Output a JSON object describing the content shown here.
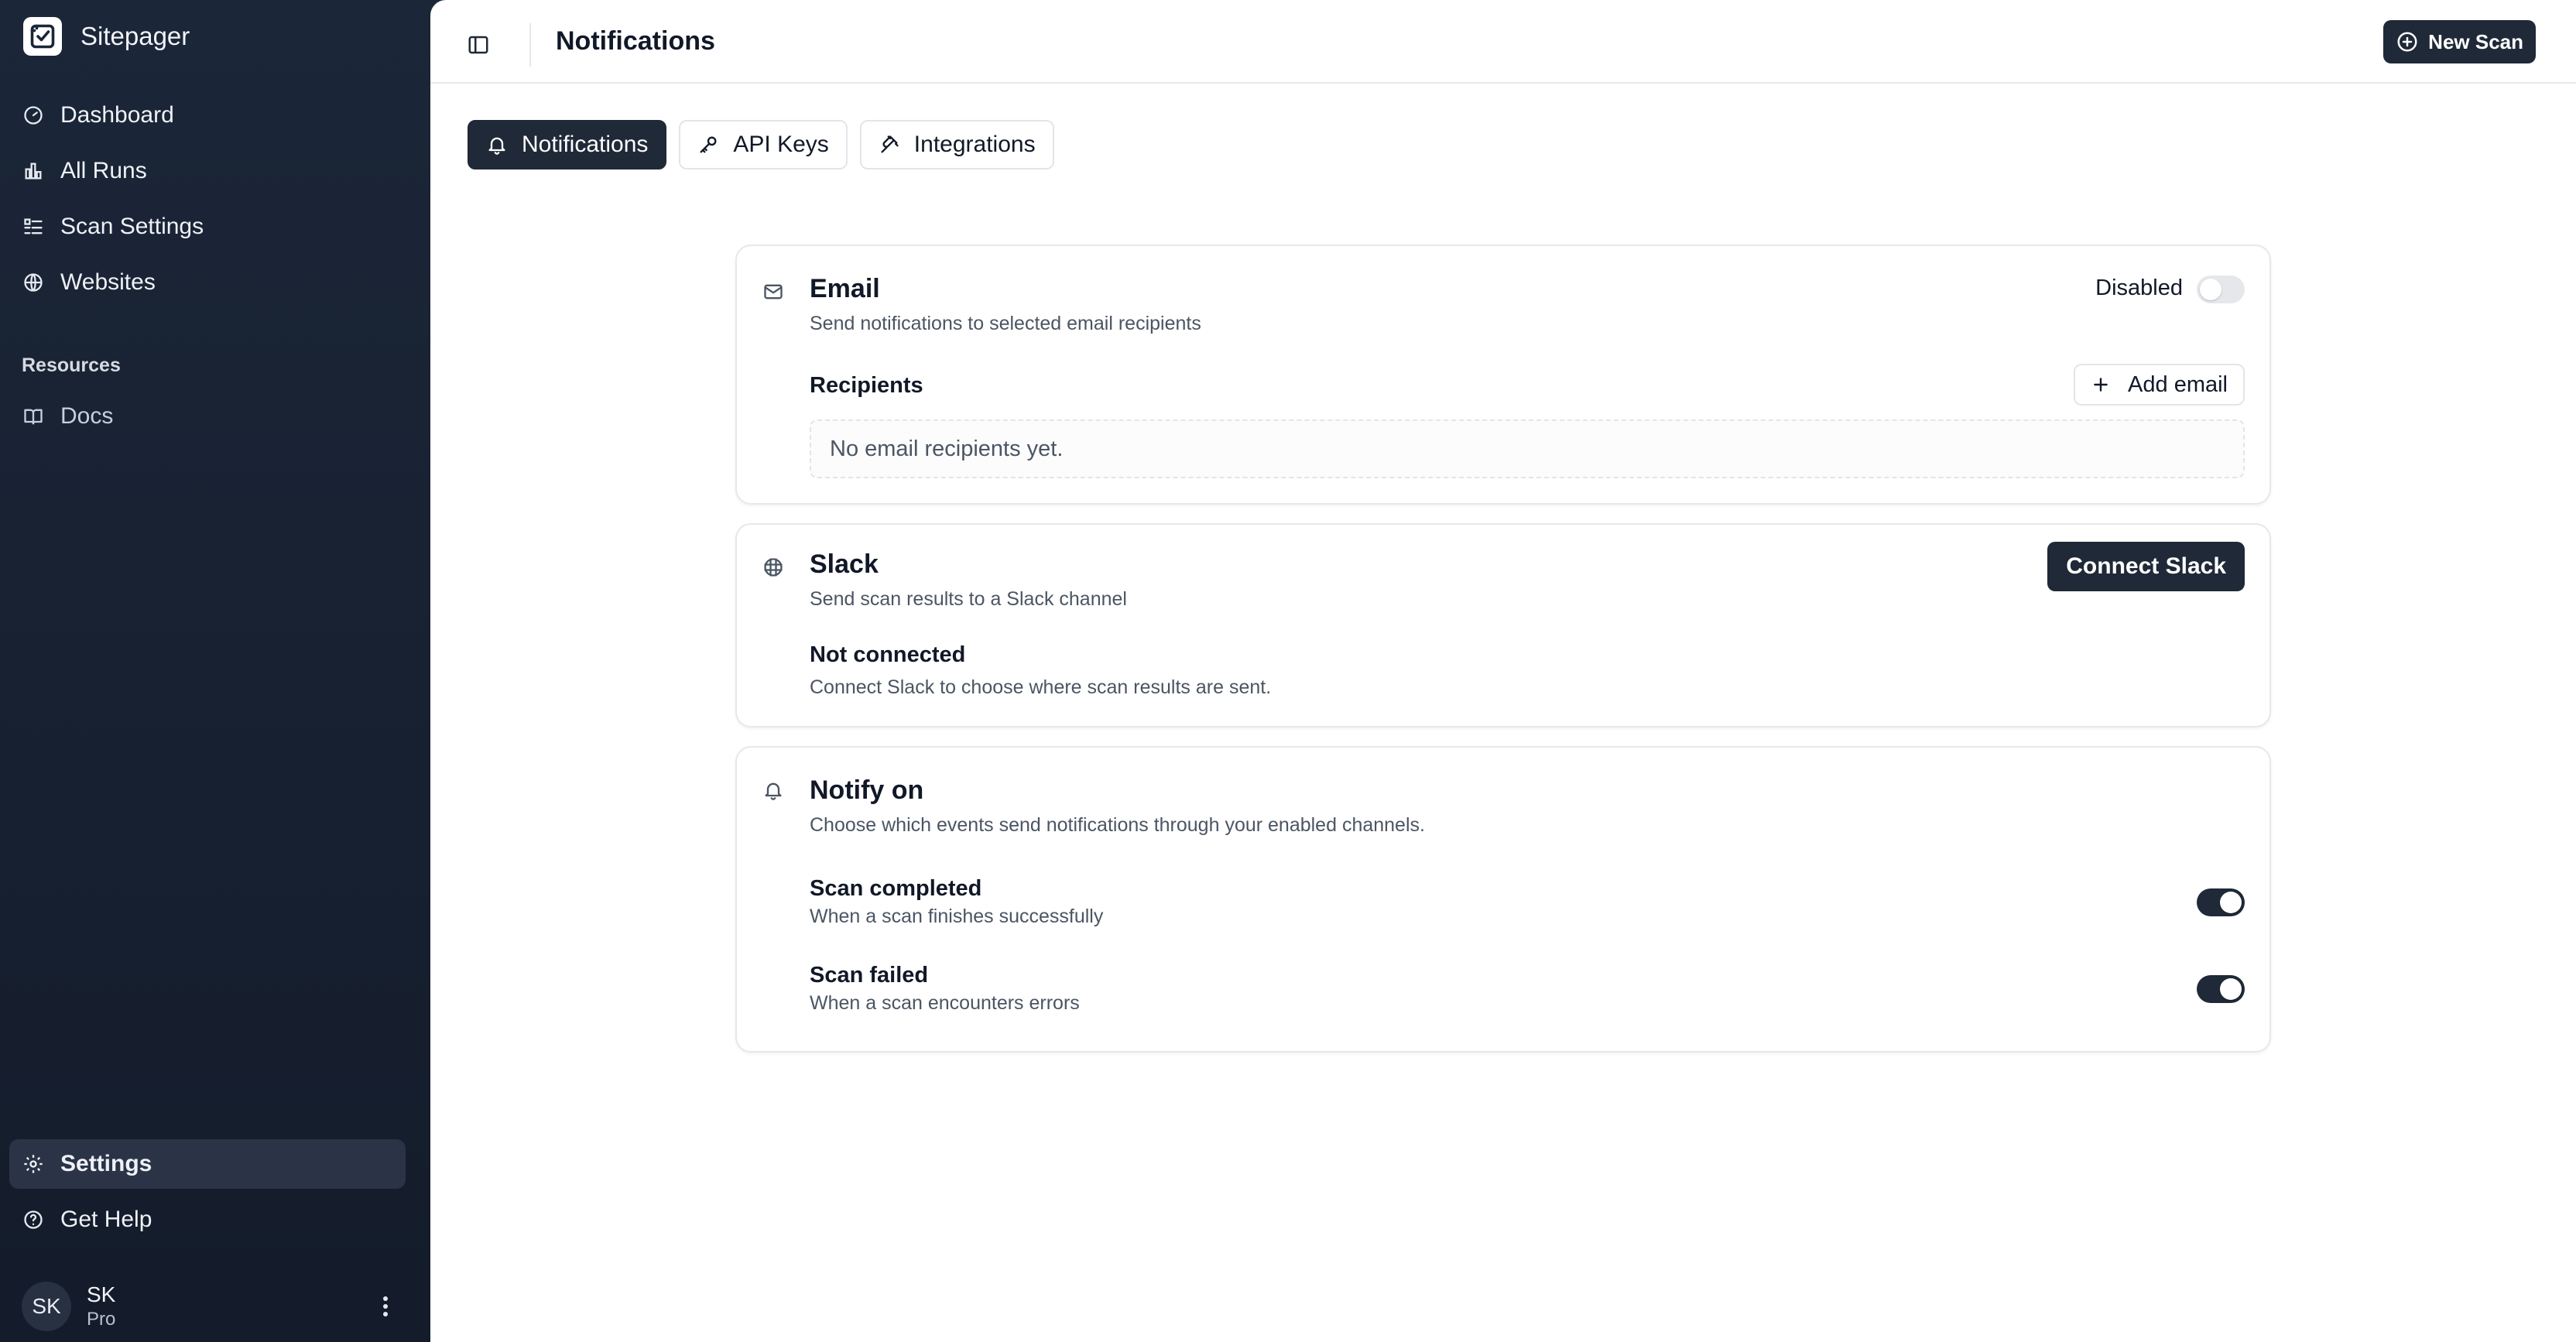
{
  "app": {
    "name": "Sitepager"
  },
  "sidebar": {
    "main_items": [
      {
        "label": "Dashboard",
        "icon": "gauge-icon"
      },
      {
        "label": "All Runs",
        "icon": "bar-chart-icon"
      },
      {
        "label": "Scan Settings",
        "icon": "list-settings-icon"
      },
      {
        "label": "Websites",
        "icon": "globe-icon"
      }
    ],
    "resources_heading": "Resources",
    "resource_items": [
      {
        "label": "Docs",
        "icon": "book-icon"
      }
    ],
    "bottom_items": [
      {
        "label": "Settings",
        "icon": "gear-icon",
        "active": true
      },
      {
        "label": "Get Help",
        "icon": "help-circle-icon"
      }
    ],
    "user": {
      "initials": "SK",
      "name": "SK",
      "plan": "Pro"
    }
  },
  "header": {
    "title": "Notifications",
    "new_scan_label": "New Scan"
  },
  "tabs": [
    {
      "label": "Notifications",
      "active": true
    },
    {
      "label": "API Keys",
      "active": false
    },
    {
      "label": "Integrations",
      "active": false
    }
  ],
  "email_card": {
    "title": "Email",
    "subtitle": "Send notifications to selected email recipients",
    "status_label": "Disabled",
    "enabled": false,
    "recipients_label": "Recipients",
    "add_email_label": "Add email",
    "empty_text": "No email recipients yet."
  },
  "slack_card": {
    "title": "Slack",
    "subtitle": "Send scan results to a Slack channel",
    "connect_label": "Connect Slack",
    "status_title": "Not connected",
    "status_desc": "Connect Slack to choose where scan results are sent."
  },
  "notify_card": {
    "title": "Notify on",
    "subtitle": "Choose which events send notifications through your enabled channels.",
    "events": [
      {
        "title": "Scan completed",
        "desc": "When a scan finishes successfully",
        "enabled": true
      },
      {
        "title": "Scan failed",
        "desc": "When a scan encounters errors",
        "enabled": true
      }
    ]
  },
  "colors": {
    "sidebar_bg": "#1b2638",
    "accent_dark": "#1f2937",
    "page_bg": "#ffffff",
    "border": "#e6e8ec"
  }
}
